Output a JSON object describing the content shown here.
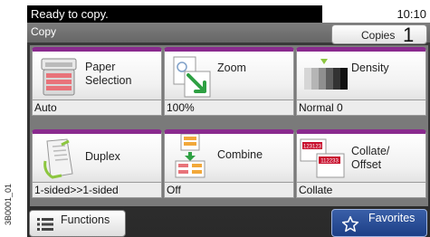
{
  "side_label": "3B0001_01",
  "status": {
    "message": "Ready to copy.",
    "time": "10:10"
  },
  "title_bar": {
    "title": "Copy",
    "copies_label": "Copies",
    "copies_count": "1"
  },
  "tiles": [
    {
      "name": "paper-selection",
      "label_line1": "Paper",
      "label_line2": "Selection",
      "value": "Auto",
      "icon": "paper-tray-icon"
    },
    {
      "name": "zoom",
      "label_line1": "Zoom",
      "label_line2": "",
      "value": "100%",
      "icon": "zoom-icon"
    },
    {
      "name": "density",
      "label_line1": "Density",
      "label_line2": "",
      "value": "Normal 0",
      "icon": "density-icon"
    },
    {
      "name": "duplex",
      "label_line1": "Duplex",
      "label_line2": "",
      "value": "1-sided>>1-sided",
      "icon": "duplex-icon"
    },
    {
      "name": "combine",
      "label_line1": "Combine",
      "label_line2": "",
      "value": "Off",
      "icon": "combine-icon"
    },
    {
      "name": "collate-offset",
      "label_line1": "Collate/",
      "label_line2": "Offset",
      "value": "Collate",
      "icon": "collate-icon",
      "icon_text_a": "123123",
      "icon_text_b": "112233"
    }
  ],
  "bottom": {
    "functions_label": "Functions",
    "favorites_label": "Favorites"
  },
  "colors": {
    "tile_accent": "#8a2a8e",
    "favorites_bg": "#1d3f86",
    "screen_bg": "#333333"
  }
}
